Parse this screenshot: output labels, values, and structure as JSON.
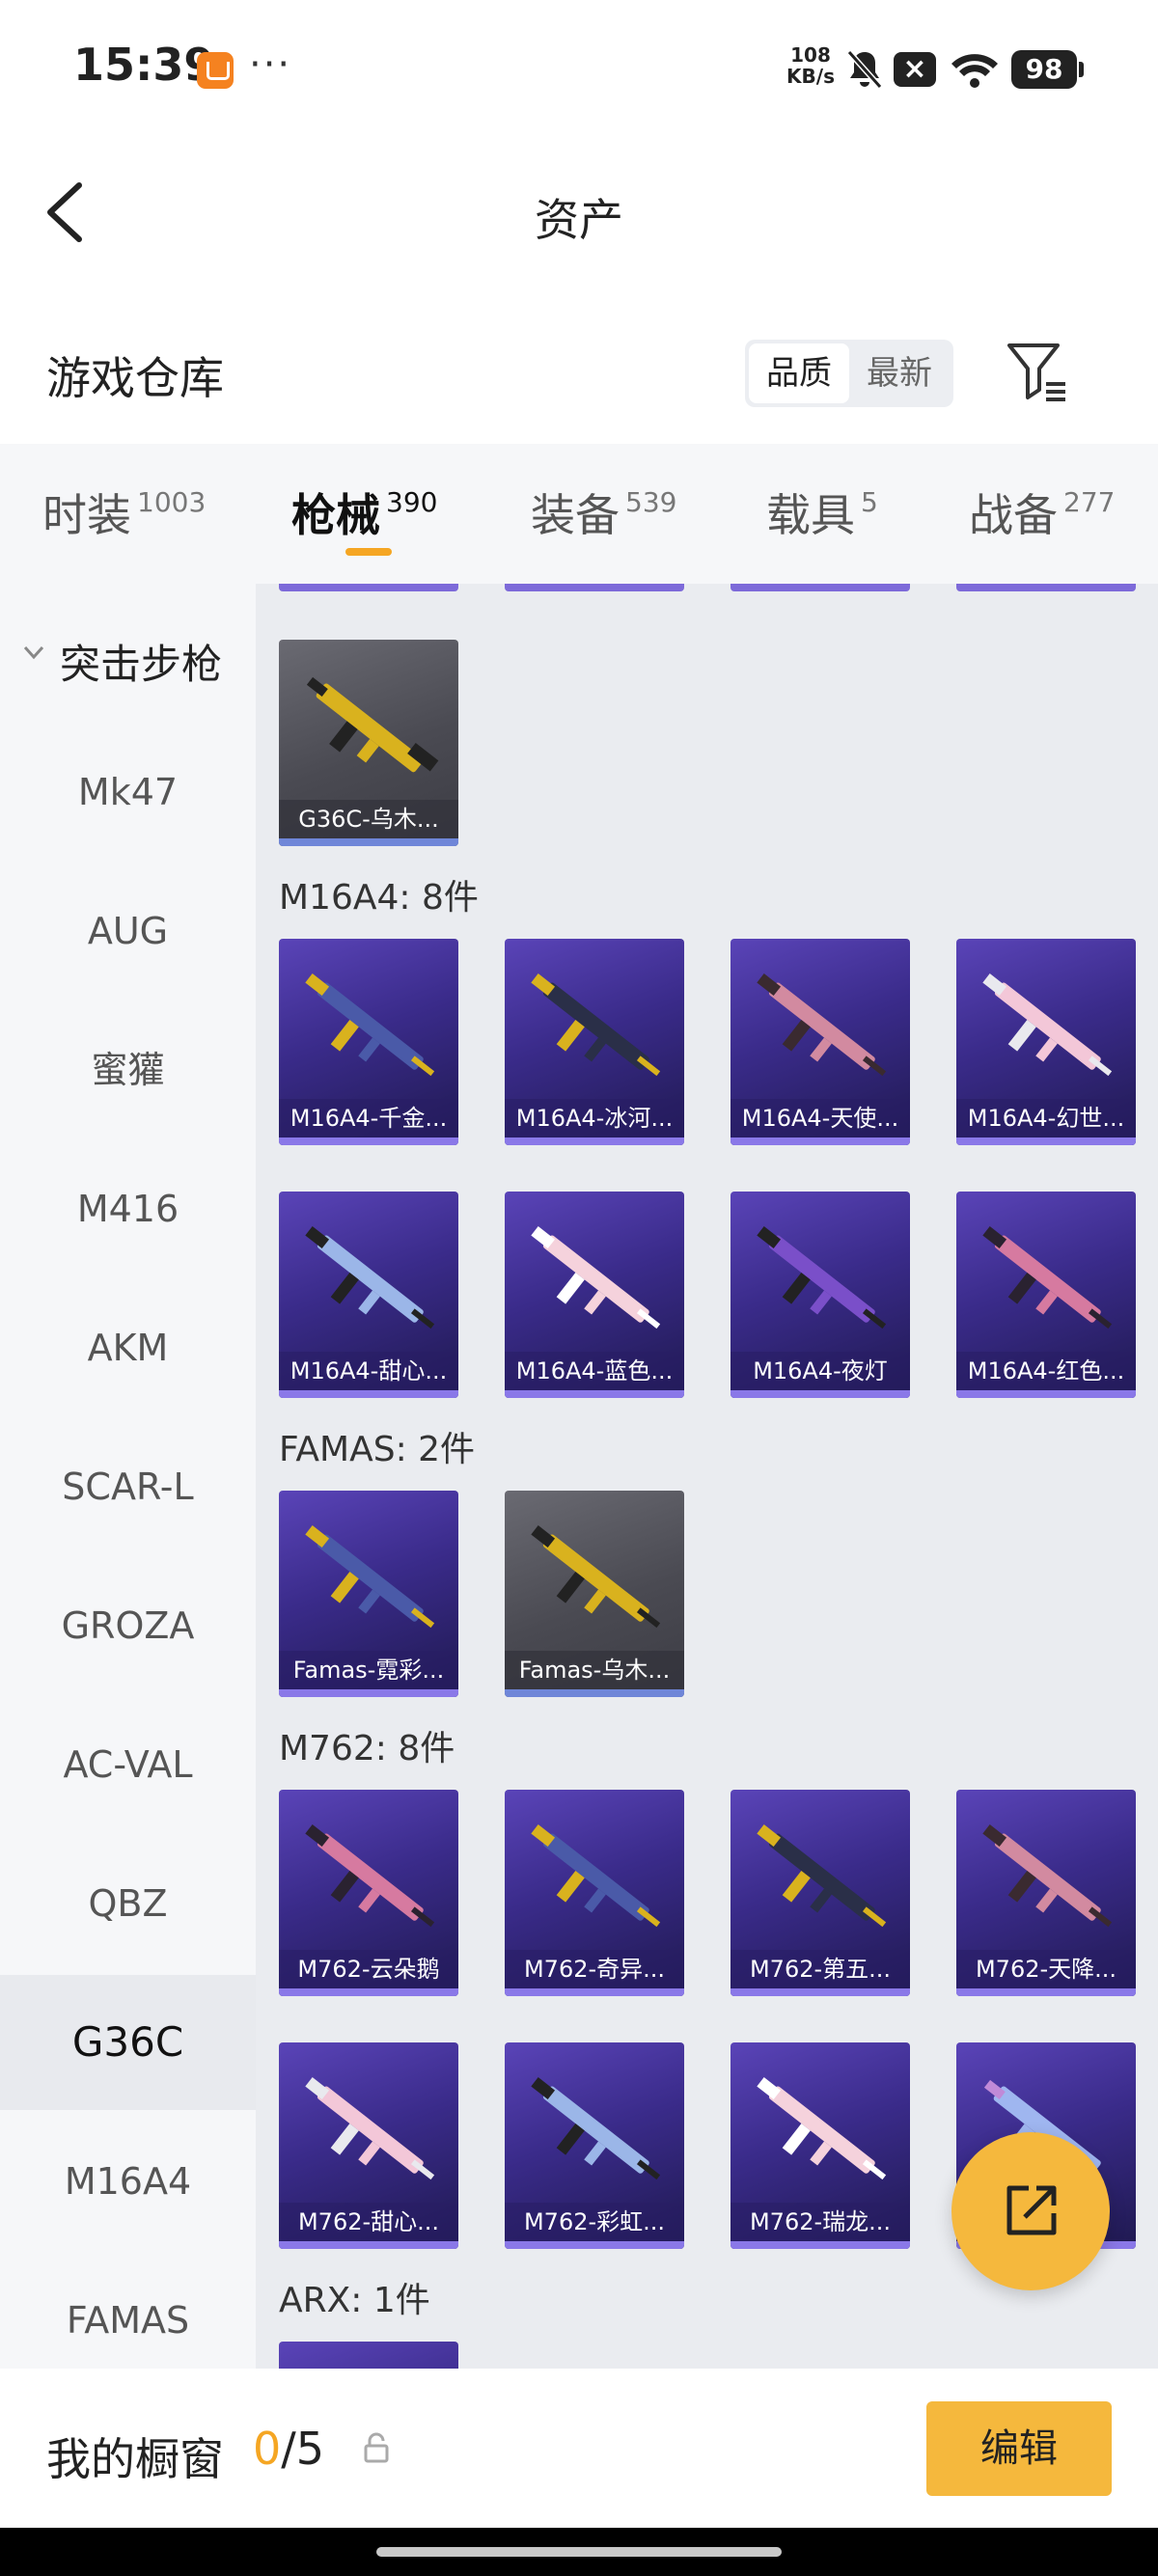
{
  "status_bar": {
    "time": "15:39",
    "speed_value": "108",
    "speed_unit": "KB/s",
    "battery": "98"
  },
  "header": {
    "title": "资产"
  },
  "warehouse": {
    "title": "游戏仓库",
    "sort_options": [
      "品质",
      "最新"
    ],
    "selected_sort": "品质"
  },
  "tabs": [
    {
      "label": "时装",
      "count": "1003"
    },
    {
      "label": "枪械",
      "count": "390"
    },
    {
      "label": "装备",
      "count": "539"
    },
    {
      "label": "载具",
      "count": "5"
    },
    {
      "label": "战备",
      "count": "277"
    }
  ],
  "active_tab": "枪械",
  "sidebar": {
    "group_label": "突击步枪",
    "items": [
      "Mk47",
      "AUG",
      "蜜獾",
      "M416",
      "AKM",
      "SCAR-L",
      "GROZA",
      "AC-VAL",
      "QBZ",
      "G36C",
      "M16A4",
      "FAMAS"
    ],
    "active": "G36C"
  },
  "sections": {
    "g36c": {
      "cards": [
        "G36C-乌木..."
      ]
    },
    "m16a4": {
      "title": "M16A4: 8件",
      "cards": [
        "M16A4-千金...",
        "M16A4-冰河...",
        "M16A4-天使...",
        "M16A4-幻世...",
        "M16A4-甜心...",
        "M16A4-蓝色...",
        "M16A4-夜灯",
        "M16A4-红色..."
      ]
    },
    "famas": {
      "title": "FAMAS: 2件",
      "cards": [
        "Famas-霓彩...",
        "Famas-乌木..."
      ]
    },
    "m762": {
      "title": "M762: 8件",
      "cards": [
        "M762-云朵鹅",
        "M762-奇异...",
        "M762-第五...",
        "M762-天降...",
        "M762-甜心...",
        "M762-彩虹...",
        "M762-瑞龙..."
      ]
    },
    "arx": {
      "title": "ARX: 1件"
    }
  },
  "bottom_bar": {
    "showcase_label": "我的橱窗",
    "showcase_current": "0",
    "showcase_total": "/5",
    "edit_label": "编辑"
  },
  "icons": [
    "app-icon",
    "more-dots-icon",
    "mute-icon",
    "close-box-icon",
    "wifi-icon",
    "battery-icon",
    "back-arrow-icon",
    "filter-icon",
    "chevron-down-icon",
    "share-external-icon",
    "lock-icon"
  ]
}
